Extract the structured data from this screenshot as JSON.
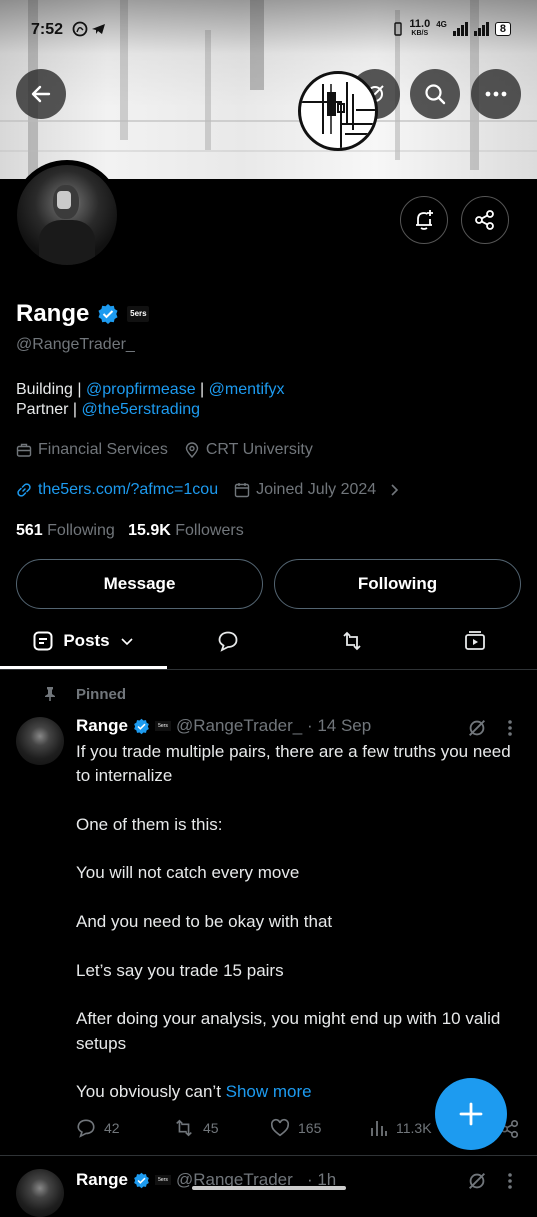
{
  "status_bar": {
    "time": "7:52",
    "speed_value": "11.0",
    "speed_unit": "KB/S",
    "network": "4G",
    "battery": "8"
  },
  "profile": {
    "name": "Range",
    "badge_label": "5ers",
    "handle": "@RangeTrader_",
    "bio": {
      "line1_prefix": "Building | ",
      "link1": "@propfirmease",
      "sep": " | ",
      "link2": "@mentifyx",
      "line2_prefix": "Partner | ",
      "link3": "@the5erstrading"
    },
    "category": "Financial Services",
    "location": "CRT University",
    "website": "the5ers.com/?afmc=1cou",
    "joined": "Joined July 2024",
    "following_count": "561",
    "following_label": "Following",
    "followers_count": "15.9K",
    "followers_label": "Followers"
  },
  "buttons": {
    "message": "Message",
    "following": "Following"
  },
  "tabs": {
    "posts": "Posts"
  },
  "pinned_post": {
    "pinned_label": "Pinned",
    "author": "Range",
    "meta": "@RangeTrader_ · 14 Sep",
    "paragraphs": [
      "If you trade multiple pairs, there are a few truths you need to internalize",
      "One of them is this:",
      "You will not catch every move",
      "And you need to be okay with that",
      "Let’s say you trade 15 pairs",
      "After doing your analysis, you might end up with 10 valid setups"
    ],
    "last_line": "You obviously can’t ",
    "show_more": "Show more",
    "replies": "42",
    "reposts": "45",
    "likes": "165",
    "views": "11.3K"
  },
  "next_post": {
    "author": "Range",
    "meta": "@RangeTrader_ · 1h"
  },
  "colors": {
    "accent": "#1d9bf0",
    "muted": "#71767b",
    "background": "#000000"
  }
}
